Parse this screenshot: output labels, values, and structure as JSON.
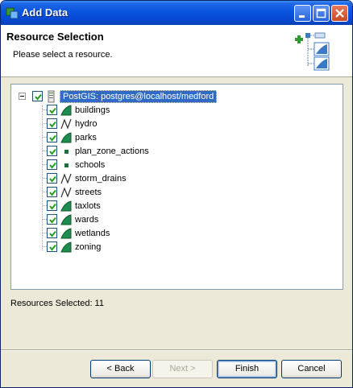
{
  "window": {
    "title": "Add Data"
  },
  "header": {
    "title": "Resource Selection",
    "description": "Please select a resource."
  },
  "tree": {
    "root": {
      "label": "PostGIS: postgres@localhost/medford",
      "checked": true,
      "icon": "database-icon"
    },
    "children": [
      {
        "label": "buildings",
        "icon": "polygon-layer-icon",
        "checked": true
      },
      {
        "label": "hydro",
        "icon": "line-layer-icon",
        "checked": true
      },
      {
        "label": "parks",
        "icon": "polygon-layer-icon",
        "checked": true
      },
      {
        "label": "plan_zone_actions",
        "icon": "point-layer-icon",
        "checked": true
      },
      {
        "label": "schools",
        "icon": "point-layer-icon",
        "checked": true
      },
      {
        "label": "storm_drains",
        "icon": "line-layer-icon",
        "checked": true
      },
      {
        "label": "streets",
        "icon": "line-layer-icon",
        "checked": true
      },
      {
        "label": "taxlots",
        "icon": "polygon-layer-icon",
        "checked": true
      },
      {
        "label": "wards",
        "icon": "polygon-layer-icon",
        "checked": true
      },
      {
        "label": "wetlands",
        "icon": "polygon-layer-icon",
        "checked": true
      },
      {
        "label": "zoning",
        "icon": "polygon-layer-icon",
        "checked": true
      }
    ]
  },
  "status": {
    "text": "Resources Selected: 11"
  },
  "buttons": {
    "back": "< Back",
    "next": "Next >",
    "finish": "Finish",
    "cancel": "Cancel"
  },
  "colors": {
    "titlebar": "#0a55de",
    "selection": "#316ac5",
    "layer_green": "#1e8c4e",
    "checkmark": "#21a121"
  }
}
